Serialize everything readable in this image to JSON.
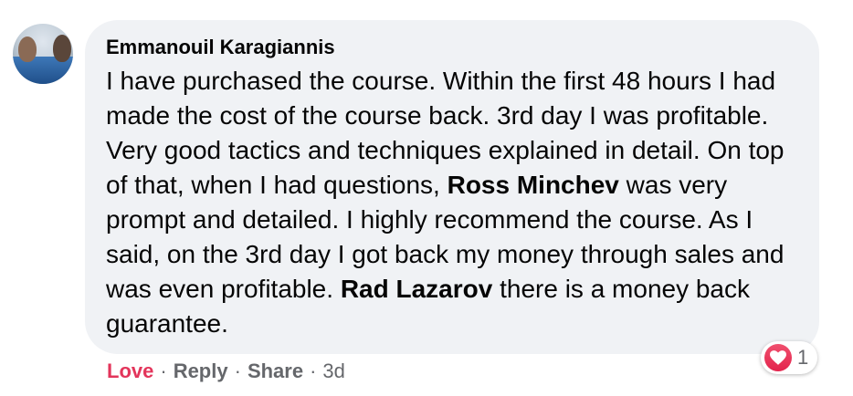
{
  "comment": {
    "author": "Emmanouil Karagiannis",
    "text_parts": [
      "I have purchased the course. Within the first 48 hours I had made the cost of the course back. 3rd day I was profitable. Very good tactics and techniques explained in detail. On top of that, when I had questions, ",
      " was very prompt and detailed. I highly recommend the course. As I said, on the 3rd day I got back my money through sales and was even profitable. ",
      " there is a money back guarantee."
    ],
    "mentions": [
      "Ross Minchev",
      "Rad Lazarov"
    ]
  },
  "reaction": {
    "icon": "heart-icon",
    "count": "1",
    "color": "#e3234c"
  },
  "actions": {
    "love_label": "Love",
    "reply_label": "Reply",
    "share_label": "Share",
    "separator": "·",
    "timestamp": "3d"
  }
}
